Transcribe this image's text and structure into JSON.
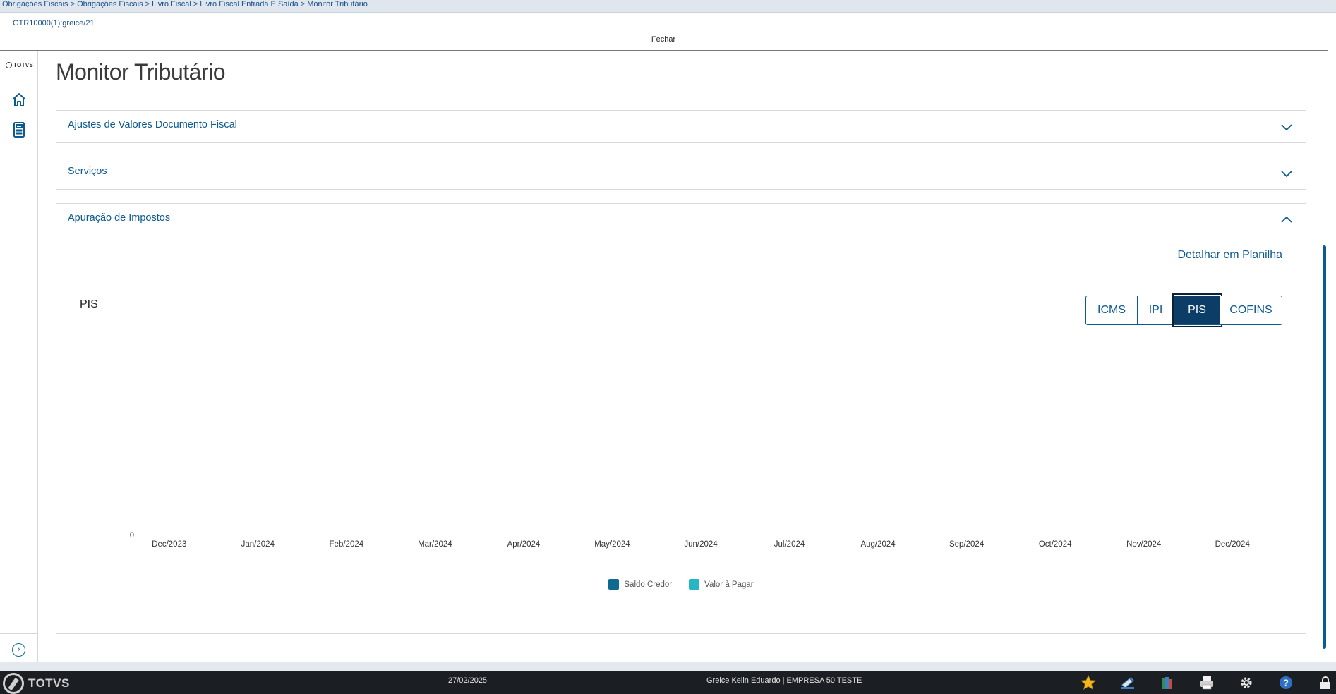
{
  "breadcrumb": "Obrigações Fiscais > Obrigações Fiscais > Livro Fiscal > Livro Fiscal Entrada E Saída > Monitor Tributário",
  "routine_id": "GTR10000(1):greice/21",
  "close_label": "Fechar",
  "sidebar": {
    "logo": "TOTVS",
    "home_icon": "home-icon",
    "calculator_icon": "calculator-icon",
    "expand_icon": "chevron-right-circle-icon"
  },
  "page_title": "Monitor Tributário",
  "sections": {
    "ajustes": {
      "title": "Ajustes de Valores Documento Fiscal",
      "expanded": false
    },
    "servicos": {
      "title": "Serviços",
      "expanded": false
    },
    "apuracao": {
      "title": "Apuração de Impostos",
      "expanded": true
    }
  },
  "detail_link": "Detalhar em Planilha",
  "tax_buttons": [
    {
      "label": "ICMS",
      "active": false
    },
    {
      "label": "IPI",
      "active": false
    },
    {
      "label": "PIS",
      "active": true
    },
    {
      "label": "COFINS",
      "active": false
    }
  ],
  "chart_data": {
    "type": "bar",
    "title": "PIS",
    "categories": [
      "Dec/2023",
      "Jan/2024",
      "Feb/2024",
      "Mar/2024",
      "Apr/2024",
      "May/2024",
      "Jun/2024",
      "Jul/2024",
      "Aug/2024",
      "Sep/2024",
      "Oct/2024",
      "Nov/2024",
      "Dec/2024"
    ],
    "series": [
      {
        "name": "Saldo Credor",
        "color": "#0f6a8f",
        "values": [
          0,
          0,
          0,
          0,
          0,
          0,
          0,
          0,
          0,
          0,
          0,
          0,
          0
        ]
      },
      {
        "name": "Valor à Pagar",
        "color": "#25b5c4",
        "values": [
          0,
          0,
          0,
          0,
          0,
          0,
          0,
          0,
          0,
          0,
          0,
          0,
          0
        ]
      }
    ],
    "y_ticks": [
      "0"
    ],
    "grid": false,
    "legend_position": "bottom"
  },
  "taskbar": {
    "logo": "TOTVS",
    "date": "27/02/2025",
    "user": "Greice Kelin Eduardo | EMPRESA 50 TESTE",
    "icons": [
      "favorites-star-icon",
      "edit-pen-icon",
      "books-icon",
      "print-icon",
      "settings-gear-icon",
      "help-icon",
      "lock-icon"
    ]
  },
  "colors": {
    "accent": "#0c5a8f",
    "active_button": "#0c3d66",
    "taskbar": "#1b1e22"
  }
}
